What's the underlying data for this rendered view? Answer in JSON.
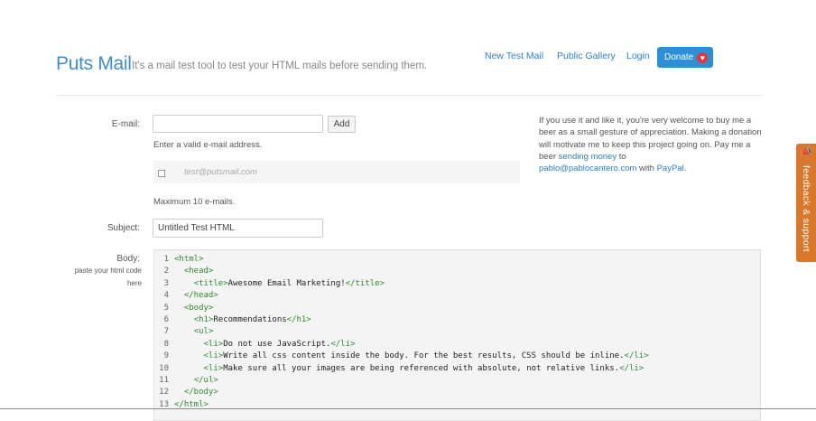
{
  "header": {
    "brand": "Puts Mail",
    "tagline": "It's a mail test tool to test your HTML mails before sending them.",
    "nav": [
      "New Test Mail",
      "Public Gallery",
      "Login"
    ],
    "donate_label": "Donate",
    "donate_icon": "heart-icon"
  },
  "form": {
    "email_label": "E-mail:",
    "email_value": "",
    "add_button": "Add",
    "email_help": "Enter a valid e-mail address.",
    "recipients": [
      {
        "email": "test@putsmail.com",
        "checked": false
      }
    ],
    "max_note": "Maximum 10 e-mails.",
    "subject_label": "Subject:",
    "subject_value": "Untitled Test HTML",
    "body_label": "Body:",
    "body_help_line1": "paste your html code",
    "body_help_line2": "here"
  },
  "sidebar": {
    "part1": "If you use it and like it, you're very welcome to buy me a beer as a small gesture of appreciation. Making a donation will motivate me to keep this project going on. Pay me a beer ",
    "link1": "sending money",
    "part2": " to",
    "email_link": "pablo@pablocantero.com",
    "part3": " with ",
    "link2": "PayPal",
    "part4": "."
  },
  "code": {
    "lines": [
      {
        "n": "1",
        "indent": "",
        "tag": "<html>",
        "text": "",
        "close": ""
      },
      {
        "n": "2",
        "indent": "  ",
        "tag": "<head>",
        "text": "",
        "close": ""
      },
      {
        "n": "3",
        "indent": "    ",
        "tag": "<title>",
        "text": "Awesome Email Marketing!",
        "close": "</title>"
      },
      {
        "n": "4",
        "indent": "  ",
        "tag": "</head>",
        "text": "",
        "close": ""
      },
      {
        "n": "5",
        "indent": "  ",
        "tag": "<body>",
        "text": "",
        "close": ""
      },
      {
        "n": "6",
        "indent": "    ",
        "tag": "<h1>",
        "text": "Recommendations",
        "close": "</h1>"
      },
      {
        "n": "7",
        "indent": "    ",
        "tag": "<ul>",
        "text": "",
        "close": ""
      },
      {
        "n": "8",
        "indent": "      ",
        "tag": "<li>",
        "text": "Do not use JavaScript.",
        "close": "</li>"
      },
      {
        "n": "9",
        "indent": "      ",
        "tag": "<li>",
        "text": "Write all css content inside the body. For the best results, CSS should be inline.",
        "close": "</li>"
      },
      {
        "n": "10",
        "indent": "      ",
        "tag": "<li>",
        "text": "Make sure all your images are being referenced with absolute, not relative links.",
        "close": "</li>"
      },
      {
        "n": "11",
        "indent": "    ",
        "tag": "</ul>",
        "text": "",
        "close": ""
      },
      {
        "n": "12",
        "indent": "  ",
        "tag": "</body>",
        "text": "",
        "close": ""
      },
      {
        "n": "13",
        "indent": "",
        "tag": "</html>",
        "text": "",
        "close": ""
      }
    ]
  },
  "feedback": {
    "label": "feedback & support",
    "icon": "megaphone-icon"
  }
}
